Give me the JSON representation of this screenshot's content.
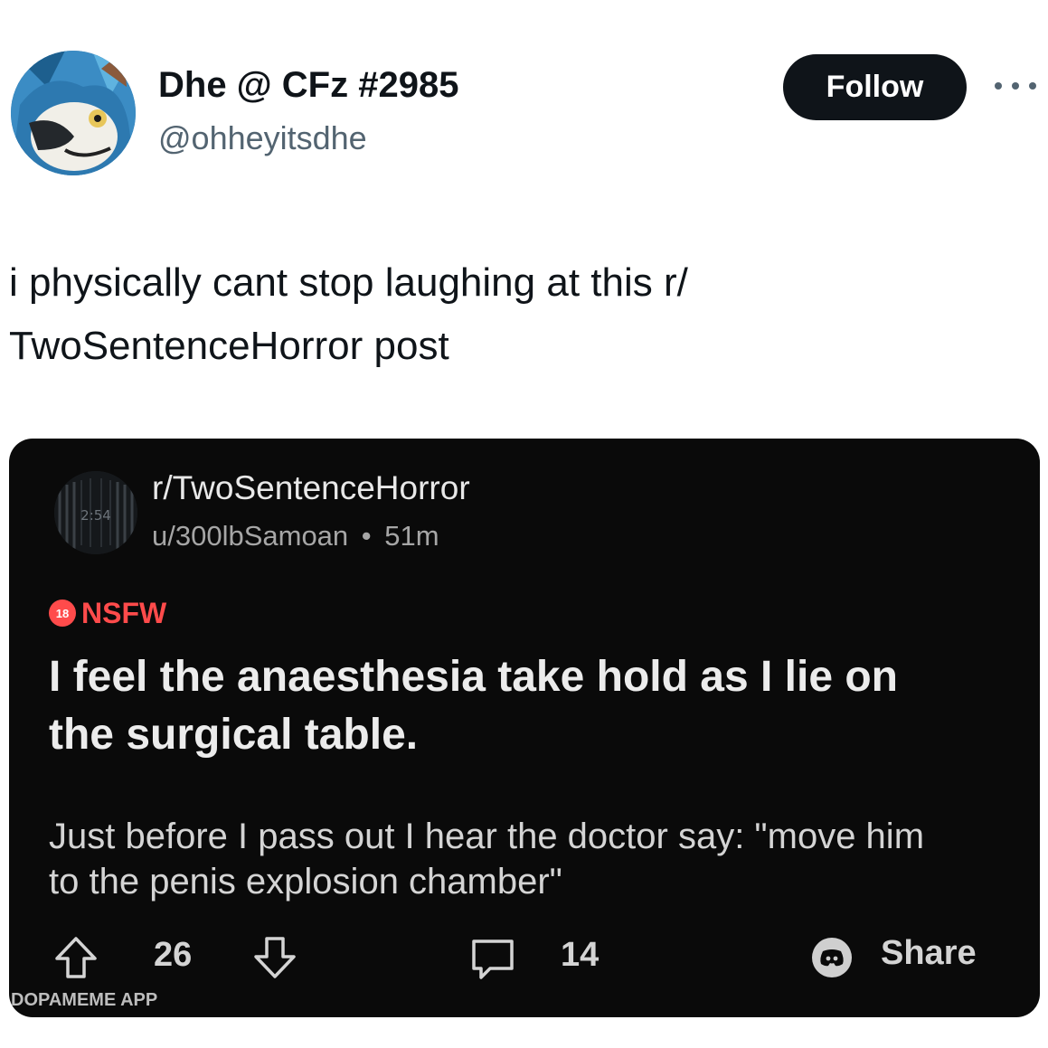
{
  "tweet": {
    "author": {
      "display_name": "Dhe @ CFz #2985",
      "handle": "@ohheyitsdhe",
      "avatar_icon": "furry-avatar"
    },
    "follow_label": "Follow",
    "more_icon": "more-options-icon",
    "text_lines": [
      "i physically cant stop laughing at this r/",
      "TwoSentenceHorror post"
    ]
  },
  "reddit_post": {
    "subreddit": "r/TwoSentenceHorror",
    "subreddit_icon_text": "2:54",
    "author": "u/300lbSamoan",
    "separator": "•",
    "age": "51m",
    "nsfw": {
      "badge_text": "18",
      "label": "NSFW",
      "color": "#ff4b4b"
    },
    "title_lines": [
      "I feel the anaesthesia take hold as I lie on",
      "the surgical table."
    ],
    "body_lines": [
      "Just before I pass out I hear the doctor say: \"move him",
      "to the penis explosion chamber\""
    ],
    "actions": {
      "upvote_icon": "upvote-arrow-icon",
      "votes": "26",
      "downvote_icon": "downvote-arrow-icon",
      "comment_icon": "comment-bubble-icon",
      "comments": "14",
      "share_icon": "discord-icon",
      "share_label": "Share"
    }
  },
  "watermark": "DOPAMEME APP",
  "colors": {
    "card_background": "#0a0a0a",
    "follow_button": "#0f1419",
    "handle_gray": "#536471"
  }
}
